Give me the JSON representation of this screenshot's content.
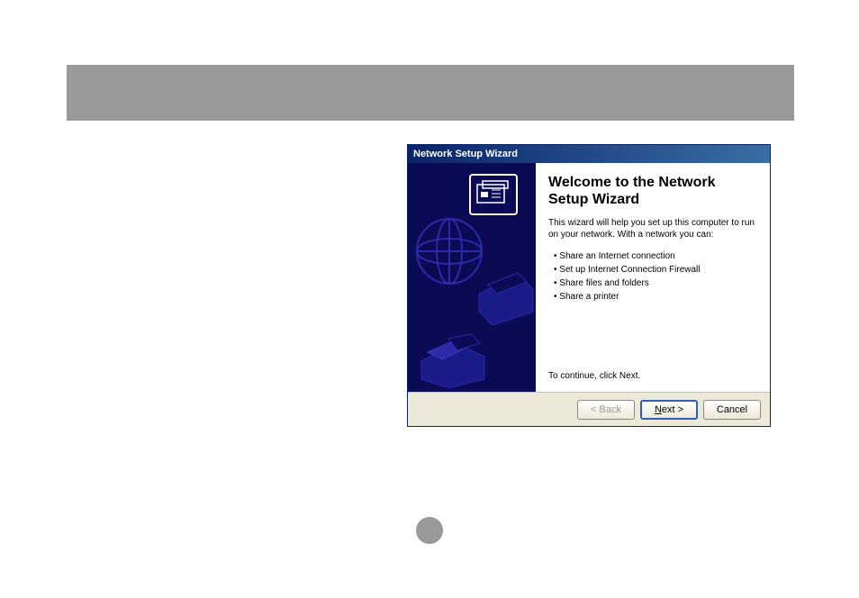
{
  "wizard": {
    "title": "Network Setup Wizard",
    "heading": "Welcome to the Network Setup Wizard",
    "description": "This wizard will help you set up this computer to run on your network. With a network you can:",
    "bullets": [
      "Share an Internet connection",
      "Set up Internet Connection Firewall",
      "Share files and folders",
      "Share a printer"
    ],
    "continue_text": "To continue, click Next.",
    "buttons": {
      "back": "< Back",
      "next": "Next >",
      "cancel": "Cancel"
    }
  }
}
